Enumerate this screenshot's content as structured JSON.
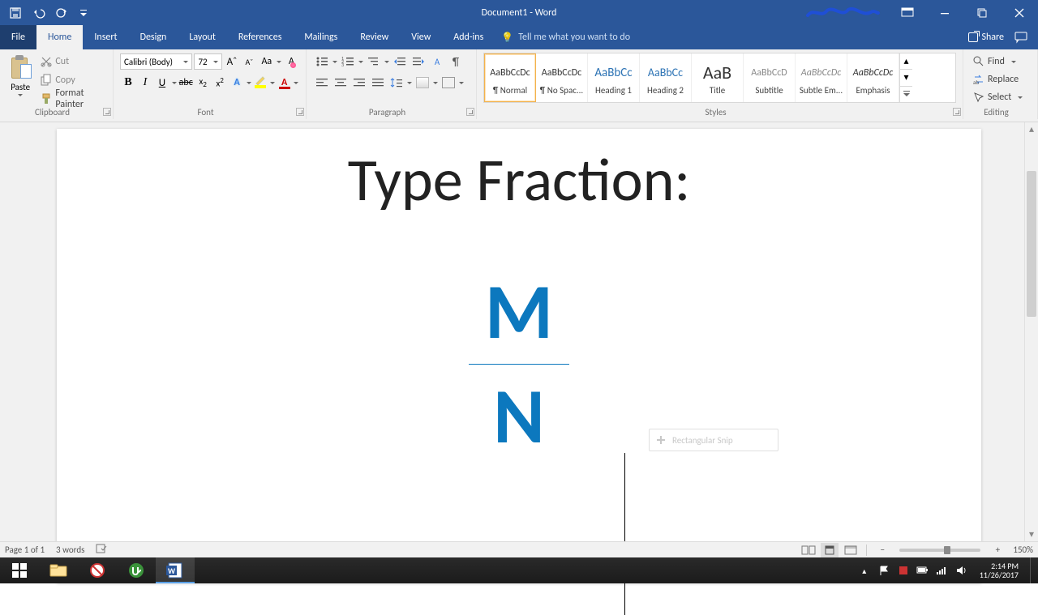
{
  "titlebar": {
    "title": "Document1 - Word"
  },
  "tabs": {
    "file": "File",
    "list": [
      "Home",
      "Insert",
      "Design",
      "Layout",
      "References",
      "Mailings",
      "Review",
      "View",
      "Add-ins"
    ],
    "active": "Home",
    "tellme": "Tell me what you want to do",
    "share": "Share"
  },
  "ribbon": {
    "clipboard": {
      "label": "Clipboard",
      "paste": "Paste",
      "cut": "Cut",
      "copy": "Copy",
      "formatpainter": "Format Painter"
    },
    "font": {
      "label": "Font",
      "name": "Calibri (Body)",
      "size": "72"
    },
    "paragraph": {
      "label": "Paragraph"
    },
    "styles": {
      "label": "Styles",
      "items": [
        {
          "preview": "AaBbCcDc",
          "name": "¶ Normal",
          "sel": true,
          "size": 12
        },
        {
          "preview": "AaBbCcDc",
          "name": "¶ No Spac...",
          "size": 12
        },
        {
          "preview": "AaBbCc",
          "name": "Heading 1",
          "size": 15,
          "color": "#2E74B5"
        },
        {
          "preview": "AaBbCc",
          "name": "Heading 2",
          "size": 14,
          "color": "#2E74B5"
        },
        {
          "preview": "AaB",
          "name": "Title",
          "size": 22
        },
        {
          "preview": "AaBbCcD",
          "name": "Subtitle",
          "size": 12,
          "color": "#888"
        },
        {
          "preview": "AaBbCcDc",
          "name": "Subtle Em...",
          "size": 12,
          "italic": true,
          "color": "#888"
        },
        {
          "preview": "AaBbCcDc",
          "name": "Emphasis",
          "size": 12,
          "italic": true
        }
      ]
    },
    "editing": {
      "label": "Editing",
      "find": "Find",
      "replace": "Replace",
      "select": "Select"
    }
  },
  "document": {
    "heading": "Type Fraction:",
    "fraction": {
      "numerator": "M",
      "denominator": "N"
    },
    "snip_label": "Rectangular Snip"
  },
  "status": {
    "page": "Page 1 of 1",
    "words": "3 words",
    "zoom": "150%"
  },
  "taskbar": {
    "time": "2:14 PM",
    "date": "11/26/2017"
  }
}
